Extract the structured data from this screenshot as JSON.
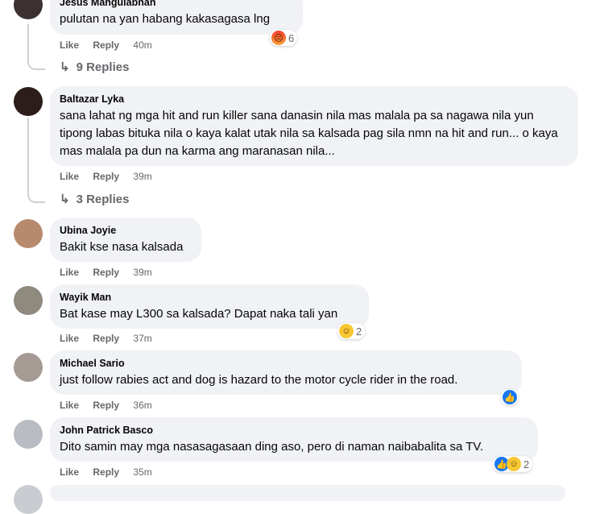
{
  "actions": {
    "like": "Like",
    "reply": "Reply"
  },
  "comments": [
    {
      "author": "Jesus Mangulabnan",
      "text": "pulutan na yan habang kakasagasa lng",
      "time": "40m",
      "reactions": [
        "angry-icon"
      ],
      "reaction_count": "6",
      "replies": "9 Replies"
    },
    {
      "author": "Baltazar Lyka",
      "text": "sana lahat ng mga hit and run killer sana danasin nila mas malala pa sa nagawa nila yun tipong labas bituka nila o kaya kalat utak nila sa kalsada pag sila nmn na hit and run... o kaya mas malala pa dun na karma ang maranasan nila...",
      "time": "39m",
      "replies": "3 Replies"
    },
    {
      "author": "Ubina Joyie",
      "text": "Bakit kse nasa kalsada",
      "time": "39m"
    },
    {
      "author": "Wayik Man",
      "text": "Bat kase may L300 sa kalsada? Dapat naka tali yan",
      "time": "37m",
      "reactions": [
        "haha-icon"
      ],
      "reaction_count": "2"
    },
    {
      "author": "Michael Sario",
      "text": "just follow rabies act and dog is hazard to the motor cycle rider in the road.",
      "time": "36m",
      "reactions": [
        "like-icon"
      ]
    },
    {
      "author": "John Patrick Basco",
      "text": "Dito samin may mga nasasagasaan ding aso, pero di naman naibabalita sa TV.",
      "time": "35m",
      "reactions": [
        "like-icon",
        "haha-icon"
      ],
      "reaction_count": "2"
    }
  ]
}
